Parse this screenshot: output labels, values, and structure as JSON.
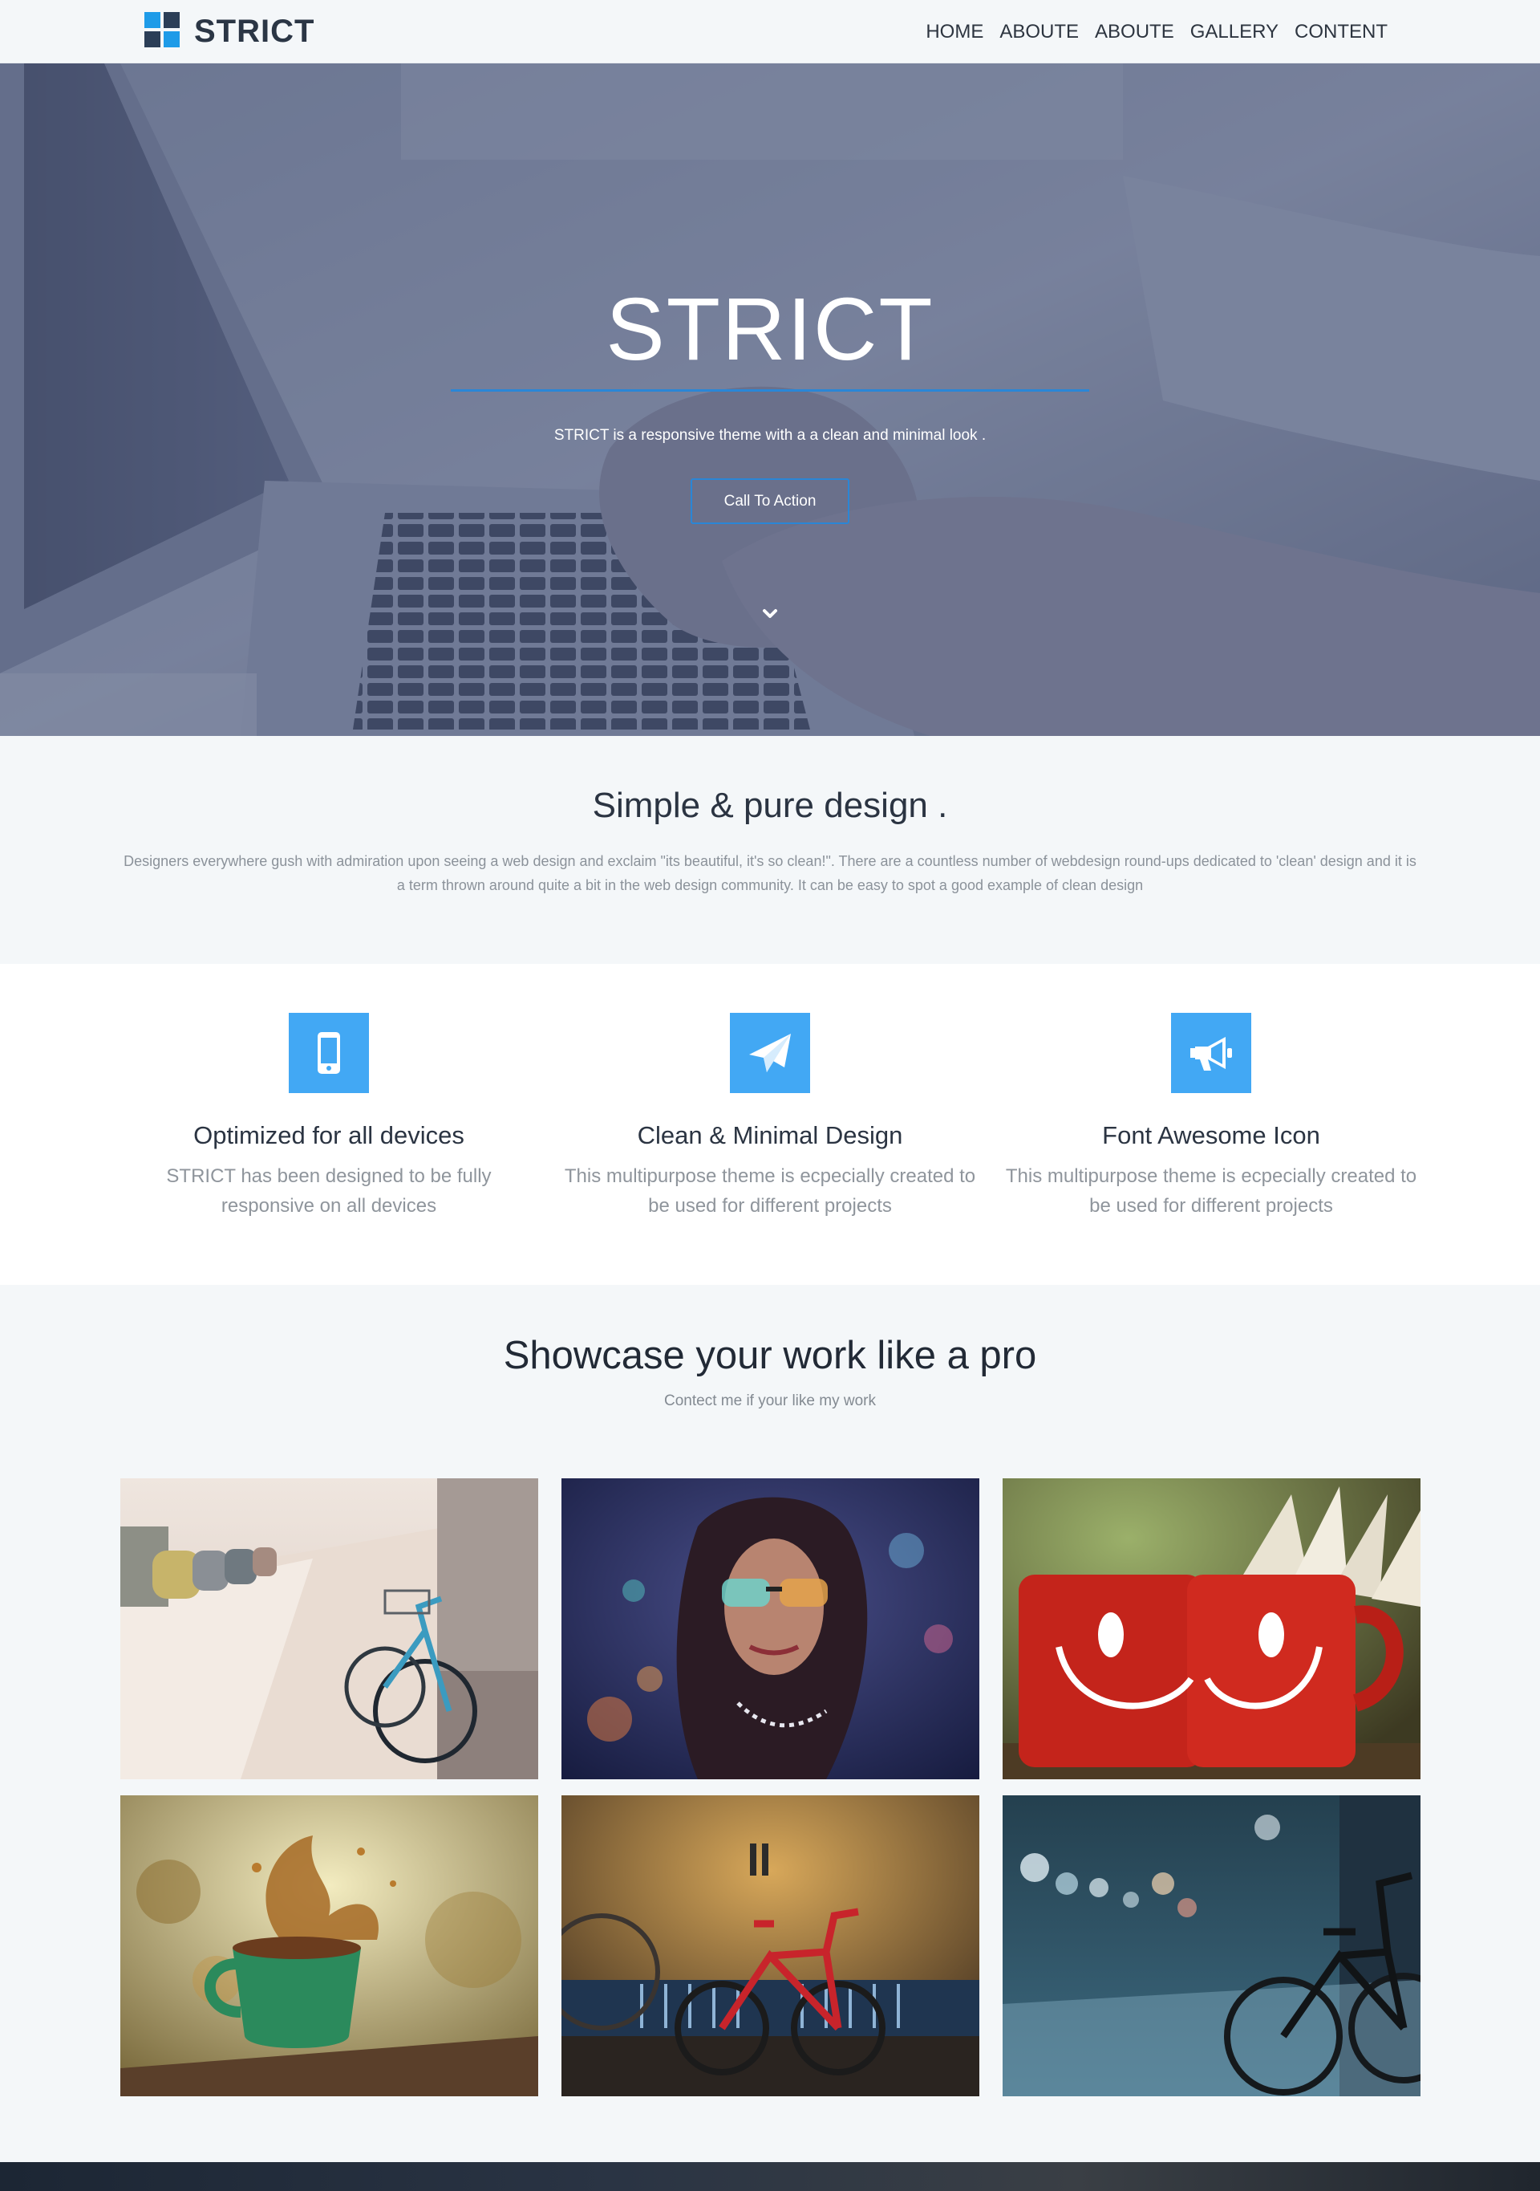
{
  "nav": {
    "brand": "STRICT",
    "links": [
      "HOME",
      "ABOUTE",
      "ABOUTE",
      "GALLERY",
      "CONTENT"
    ]
  },
  "hero": {
    "title": "STRICT",
    "subtitle": "STRICT is a responsive theme with a a clean and minimal look .",
    "cta": "Call To Action",
    "scroll_icon": "chevron-down-icon"
  },
  "intro": {
    "title": "Simple & pure design .",
    "text": "Designers everywhere gush with admiration upon seeing a web design and exclaim \"its beautiful, it's so clean!\". There are a countless number of webdesign round-ups dedicated to 'clean' design and it is a term thrown around quite a bit in the web design community. It can be easy to spot a good example of clean design"
  },
  "features": [
    {
      "icon": "mobile-phone-icon",
      "title": "Optimized for all devices",
      "text": "STRICT has been designed to be fully responsive on all devices"
    },
    {
      "icon": "paper-plane-icon",
      "title": "Clean & Minimal Design",
      "text": "This multipurpose theme is ecpecially created to be used for different projects"
    },
    {
      "icon": "bullhorn-icon",
      "title": "Font Awesome Icon",
      "text": "This multipurpose theme is ecpecially created to be used for different projects"
    }
  ],
  "showcase": {
    "title": "Showcase your work like a pro",
    "subtitle": "Contect me if your like my work",
    "tiles": [
      "bicycle-street-photo",
      "woman-sunglasses-photo",
      "smiley-mugs-photo",
      "coffee-splash-photo",
      "red-bicycle-photo",
      "night-bicycle-photo"
    ]
  },
  "colors": {
    "accent": "#42a8f4",
    "brand_dark": "#2b3e57",
    "cta_border": "#2a86d6",
    "page_bg": "#f4f7f9"
  }
}
